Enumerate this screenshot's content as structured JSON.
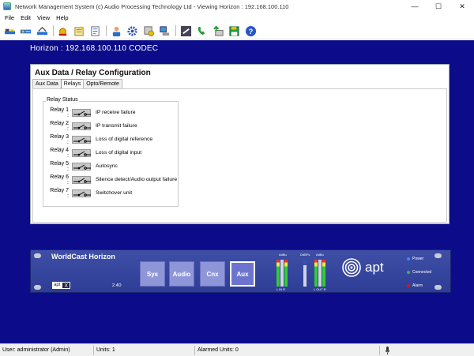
{
  "window": {
    "title": "Network Management System (c) Audio Processing Technology Ltd - Viewing Horizon : 192.168.100.110",
    "minimize": "—",
    "maximize": "☐",
    "close": "✕"
  },
  "menu": [
    "File",
    "Edit",
    "View",
    "Help"
  ],
  "toolbar": {
    "icons": [
      "network-view-icon",
      "device-list-icon",
      "scan-icon",
      "alarm-bell-icon",
      "alarm-log-icon",
      "report-icon",
      "user-icon",
      "settings-gear-icon",
      "configure-icon",
      "device-icon",
      "transfer-icon",
      "phone-icon",
      "firmware-upload-icon",
      "save-icon",
      "help-icon"
    ]
  },
  "header": {
    "device": "Horizon : 192.168.100.110 CODEC"
  },
  "panel": {
    "title": "Aux Data / Relay Configuration",
    "tabs": [
      "Aux Data",
      "Relays",
      "Opto/Remote"
    ],
    "active_tab": "Relays",
    "group_label": "Relay Status",
    "relays": [
      {
        "name": "Relay 1 :",
        "desc": "IP receive failure"
      },
      {
        "name": "Relay 2 :",
        "desc": "IP transmit failure"
      },
      {
        "name": "Relay 3 :",
        "desc": "Loss of digital reference"
      },
      {
        "name": "Relay 4 :",
        "desc": "Loss of digital input"
      },
      {
        "name": "Relay 5 :",
        "desc": "Autosync"
      },
      {
        "name": "Relay 6 :",
        "desc": "Silence detect/Audio output failure"
      },
      {
        "name": "Relay 7 :",
        "desc": "Switchover unit"
      }
    ]
  },
  "device": {
    "name": "WorldCast Horizon",
    "aptx_a": "apt",
    "aptx_x": "X",
    "version": "2.4D",
    "buttons": [
      "Sys",
      "Audio",
      "Cnx",
      "Aux"
    ],
    "active_button": "Aux",
    "meters": {
      "in_label": "AdBu",
      "delay_label": "DdBFs",
      "out_label": "AdBu",
      "in_lr": "L  IN  R",
      "out_lr": "L OUT R"
    },
    "logo": "apt",
    "leds": [
      {
        "label": "Power",
        "color": "#2f8fff"
      },
      {
        "label": "Connected",
        "color": "#2fbf3f"
      },
      {
        "label": "Alarm",
        "color": "#c81e1e"
      }
    ]
  },
  "status": {
    "user": "User: administrator (Admin)",
    "units": "Units: 1",
    "alarmed": "Alarmed Units: 0"
  }
}
